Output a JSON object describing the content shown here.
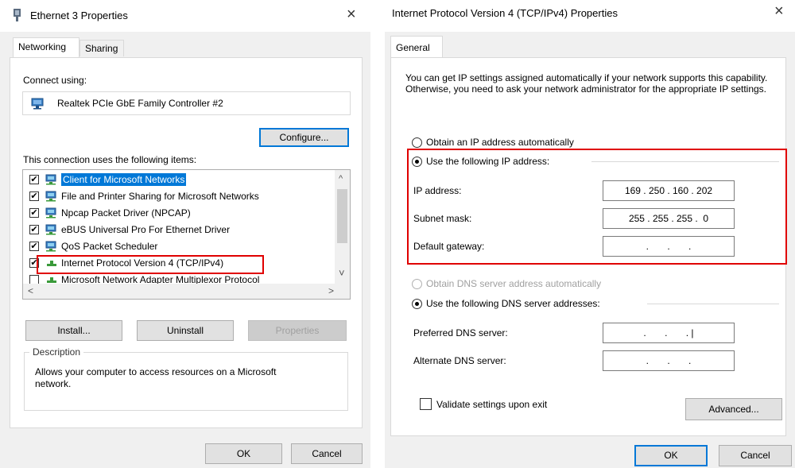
{
  "left_dialog": {
    "title": "Ethernet 3 Properties",
    "close_glyph": "×",
    "tabs": [
      {
        "label": "Networking",
        "active": true
      },
      {
        "label": "Sharing",
        "active": false
      }
    ],
    "connect_using_label": "Connect using:",
    "adapter_name": "Realtek PCIe GbE Family Controller #2",
    "configure_label": "Configure...",
    "items_label": "This connection uses the following items:",
    "items": [
      {
        "label": "Client for Microsoft Networks",
        "checked": true,
        "selected": true,
        "icon": "network-client-icon"
      },
      {
        "label": "File and Printer Sharing for Microsoft Networks",
        "checked": true,
        "selected": false,
        "icon": "network-service-icon"
      },
      {
        "label": "Npcap Packet Driver (NPCAP)",
        "checked": true,
        "selected": false,
        "icon": "network-service-icon"
      },
      {
        "label": "eBUS Universal Pro For Ethernet Driver",
        "checked": true,
        "selected": false,
        "icon": "network-service-icon"
      },
      {
        "label": "QoS Packet Scheduler",
        "checked": true,
        "selected": false,
        "icon": "network-service-icon"
      },
      {
        "label": "Internet Protocol Version 4 (TCP/IPv4)",
        "checked": true,
        "selected": false,
        "icon": "protocol-icon"
      },
      {
        "label": "Microsoft Network Adapter Multiplexor Protocol",
        "checked": false,
        "selected": false,
        "icon": "protocol-icon"
      }
    ],
    "scroll_up_glyph": "^",
    "scroll_down_glyph": "˅",
    "scroll_left_glyph": "<",
    "scroll_right_glyph": ">",
    "install_label": "Install...",
    "uninstall_label": "Uninstall",
    "properties_label": "Properties",
    "description_title": "Description",
    "description_text": "Allows your computer to access resources on a Microsoft network.",
    "ok_label": "OK",
    "cancel_label": "Cancel"
  },
  "right_dialog": {
    "title": "Internet Protocol Version 4 (TCP/IPv4) Properties",
    "close_glyph": "×",
    "tab_label": "General",
    "intro_text": "You can get IP settings assigned automatically if your network supports this capability. Otherwise, you need to ask your network administrator for the appropriate IP settings.",
    "obtain_ip_auto_label": "Obtain an IP address automatically",
    "use_following_ip_label": "Use the following IP address:",
    "ip_address_label": "IP address:",
    "ip_address_value": "169 . 250 . 160 . 202",
    "subnet_mask_label": "Subnet mask:",
    "subnet_mask_value": "255 . 255 . 255 .  0",
    "default_gateway_label": "Default gateway:",
    "default_gateway_value": ".       .       .",
    "obtain_dns_auto_label": "Obtain DNS server address automatically",
    "use_following_dns_label": "Use the following DNS server addresses:",
    "preferred_dns_label": "Preferred DNS server:",
    "preferred_dns_value": ".       .       . |",
    "alternate_dns_label": "Alternate DNS server:",
    "alternate_dns_value": ".       .       .",
    "validate_label": "Validate settings upon exit",
    "advanced_label": "Advanced...",
    "ok_label": "OK",
    "cancel_label": "Cancel"
  },
  "colors": {
    "highlight_annotation": "#e00000",
    "selection_blue": "#0078d7",
    "dialog_bg": "#f0f0f0"
  }
}
